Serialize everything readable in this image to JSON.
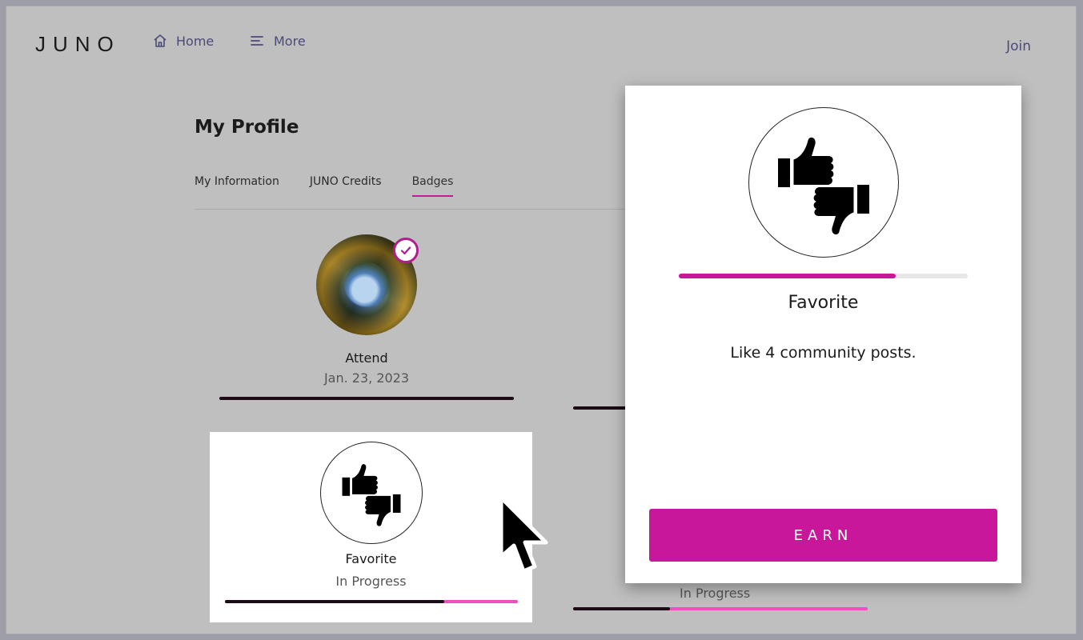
{
  "header": {
    "logo": "JUNO",
    "nav": [
      {
        "label": "Home",
        "icon": "home-icon"
      },
      {
        "label": "More",
        "icon": "menu-icon"
      }
    ],
    "join_label": "Join"
  },
  "profile": {
    "title": "My Profile",
    "tabs": [
      {
        "label": "My Information",
        "active": false
      },
      {
        "label": "JUNO Credits",
        "active": false
      },
      {
        "label": "Badges",
        "active": true
      }
    ]
  },
  "badges": [
    {
      "name": "Attend",
      "status": "Jan. 23, 2023",
      "progress": 1.0,
      "earned": true
    },
    {
      "name": "Favorite",
      "status": "In Progress",
      "progress": 0.75,
      "earned": false
    },
    {
      "name": "",
      "status": "In Progress",
      "progress": 0.33,
      "earned": false
    }
  ],
  "modal": {
    "title": "Favorite",
    "description": "Like 4 community posts.",
    "progress": 0.75,
    "button_label": "EARN"
  },
  "colors": {
    "accent": "#c9179c",
    "progress_fill": "#ee4fc4",
    "progress_done": "#1c0a16",
    "nav_text": "#4a4a7a"
  }
}
